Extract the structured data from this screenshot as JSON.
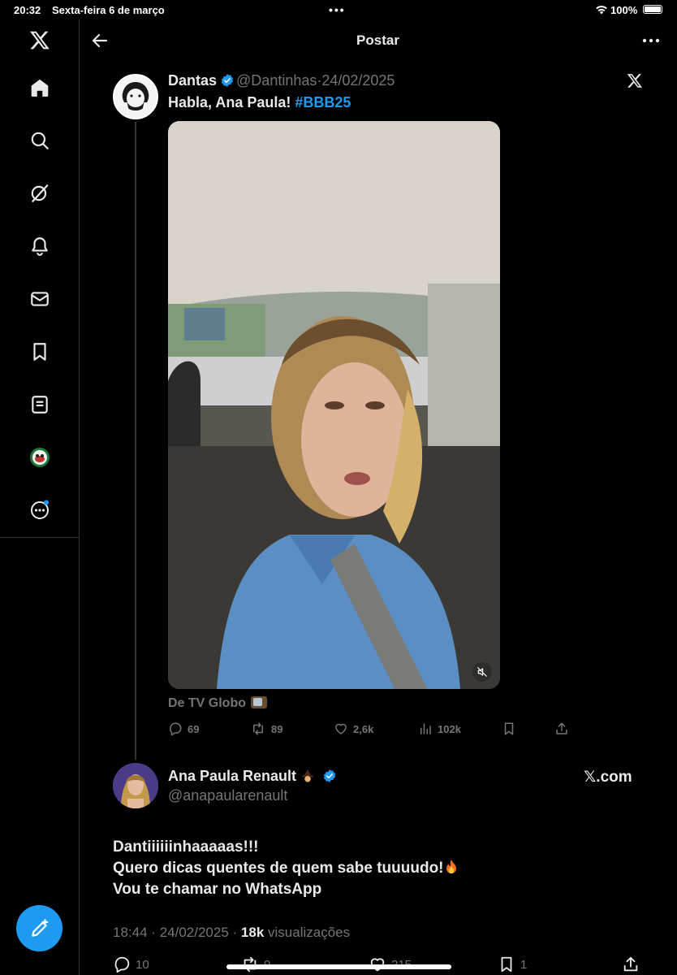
{
  "status_bar": {
    "time": "20:32",
    "date": "Sexta-feira 6 de março",
    "dots": "•••",
    "battery": "100%"
  },
  "header": {
    "title": "Postar"
  },
  "sidebar": {
    "items": [
      {
        "icon": "x-logo-icon"
      },
      {
        "icon": "home-icon"
      },
      {
        "icon": "search-icon"
      },
      {
        "icon": "grok-icon"
      },
      {
        "icon": "bell-icon"
      },
      {
        "icon": "mail-icon"
      },
      {
        "icon": "bookmark-icon"
      },
      {
        "icon": "list-icon"
      },
      {
        "icon": "profile-avatar"
      },
      {
        "icon": "more-icon"
      }
    ],
    "compose_icon": "compose-icon"
  },
  "quoted_tweet": {
    "name": "Dantas",
    "handle": "@Dantinhas",
    "separator": "·",
    "date": "24/02/2025",
    "text_prefix": "Habla, Ana Paula! ",
    "hashtag": "#BBB25",
    "source": "De TV Globo",
    "replies": "69",
    "retweets": "89",
    "likes": "2,6k",
    "views": "102k"
  },
  "main_tweet": {
    "name": "Ana Paula Renault",
    "handle": "@anapaularenault",
    "site": "𝕏.com",
    "body_line1": "Dantiiiiiinhaaaaas!!!",
    "body_line2": "Quero dicas quentes de quem sabe tuuuudo!",
    "body_line3": "Vou te chamar no WhatsApp",
    "time": "18:44",
    "separator": "·",
    "date": "24/02/2025",
    "views_count": "18k",
    "views_label": "visualizações",
    "replies": "10",
    "retweets": "9",
    "likes": "215",
    "bookmarks": "1"
  },
  "colors": {
    "accent": "#1d9bf0",
    "background": "#000000",
    "muted": "#71767b",
    "text": "#e7e9ea"
  }
}
